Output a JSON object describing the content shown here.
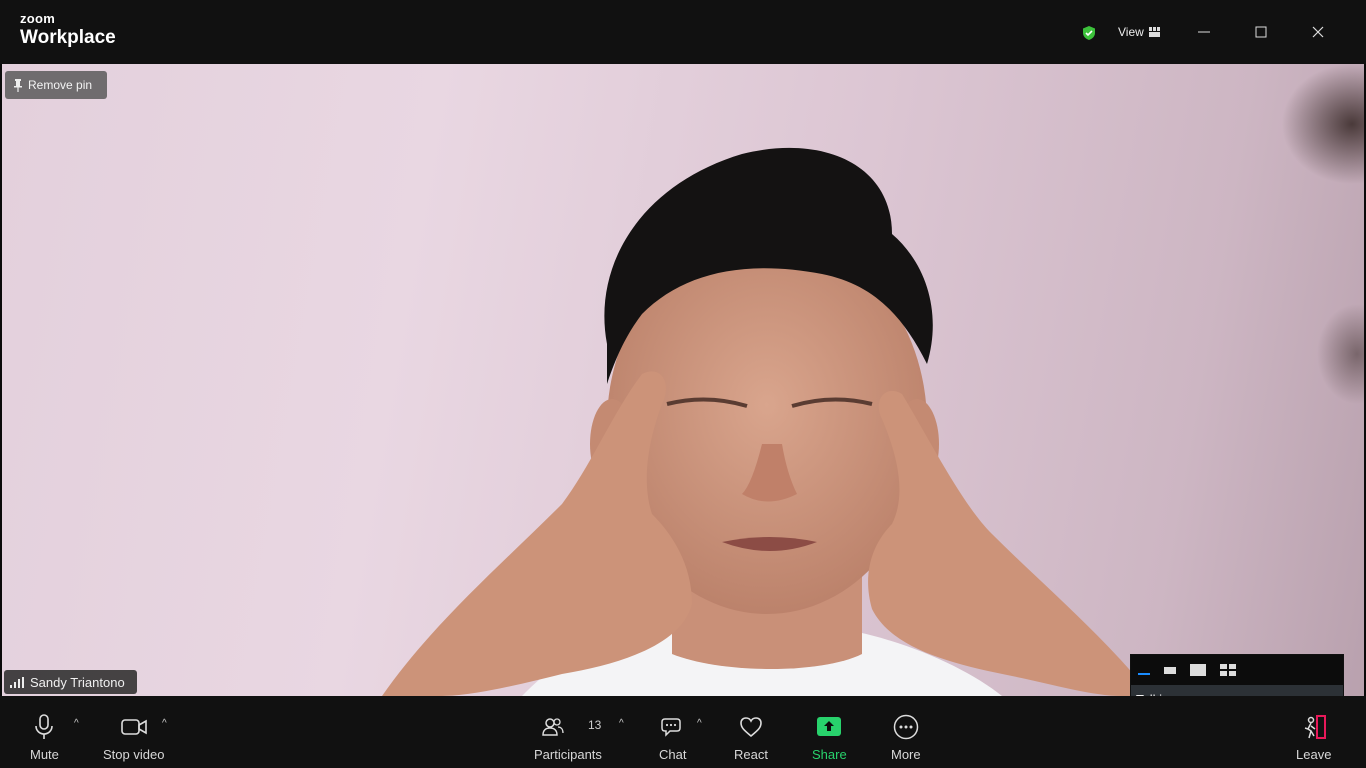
{
  "titlebar": {
    "brand_top": "zoom",
    "brand_bottom": "Workplace",
    "view_label": "View"
  },
  "video": {
    "remove_pin_label": "Remove pin",
    "participant_name": "Sandy Triantono"
  },
  "talking_panel": {
    "label": "Talking:"
  },
  "toolbar": {
    "mute_label": "Mute",
    "stop_video_label": "Stop video",
    "participants_label": "Participants",
    "participants_count": "13",
    "chat_label": "Chat",
    "react_label": "React",
    "share_label": "Share",
    "more_label": "More",
    "leave_label": "Leave"
  },
  "colors": {
    "shield": "#3cc13b",
    "share": "#28d26c",
    "leave": "#e8195a",
    "active_view": "#1a8cff"
  }
}
